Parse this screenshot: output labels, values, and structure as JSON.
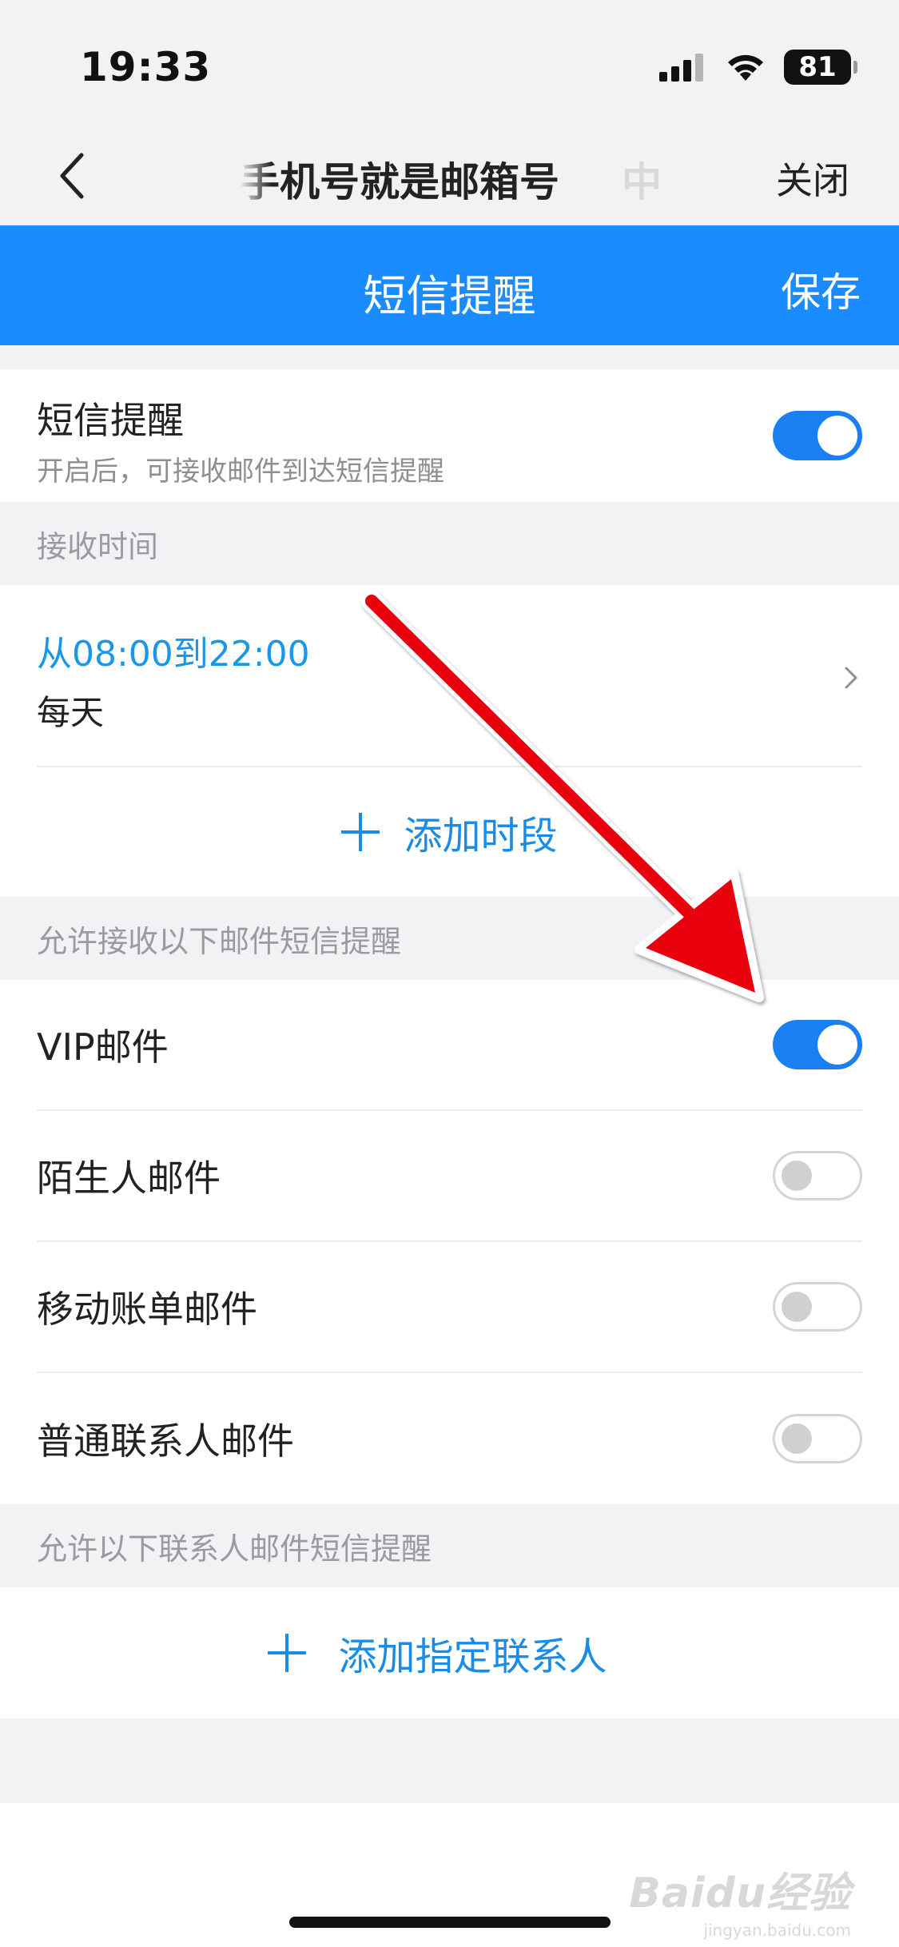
{
  "status_bar": {
    "time": "19:33",
    "battery": "81"
  },
  "nav": {
    "title": "手机号就是邮箱号",
    "extra_tab": "中",
    "close_label": "关闭"
  },
  "header": {
    "title": "短信提醒",
    "save_label": "保存"
  },
  "sms_toggle": {
    "title": "短信提醒",
    "subtitle": "开启后，可接收邮件到达短信提醒",
    "enabled": true
  },
  "receive_time": {
    "section_label": "接收时间",
    "range": "从08:00到22:00",
    "days": "每天",
    "add_label": "添加时段"
  },
  "mail_types": {
    "section_label": "允许接收以下邮件短信提醒",
    "items": [
      {
        "label": "VIP邮件",
        "enabled": true
      },
      {
        "label": "陌生人邮件",
        "enabled": false
      },
      {
        "label": "移动账单邮件",
        "enabled": false
      },
      {
        "label": "普通联系人邮件",
        "enabled": false
      }
    ]
  },
  "contacts": {
    "section_label": "允许以下联系人邮件短信提醒",
    "add_label": "添加指定联系人"
  },
  "watermark": {
    "main": "Baidu经验",
    "sub": "jingyan.baidu.com"
  },
  "colors": {
    "accent": "#1a8cff",
    "toggle_on": "#1a7ff0",
    "arrow": "#e8000b",
    "link": "#1a97e6"
  }
}
